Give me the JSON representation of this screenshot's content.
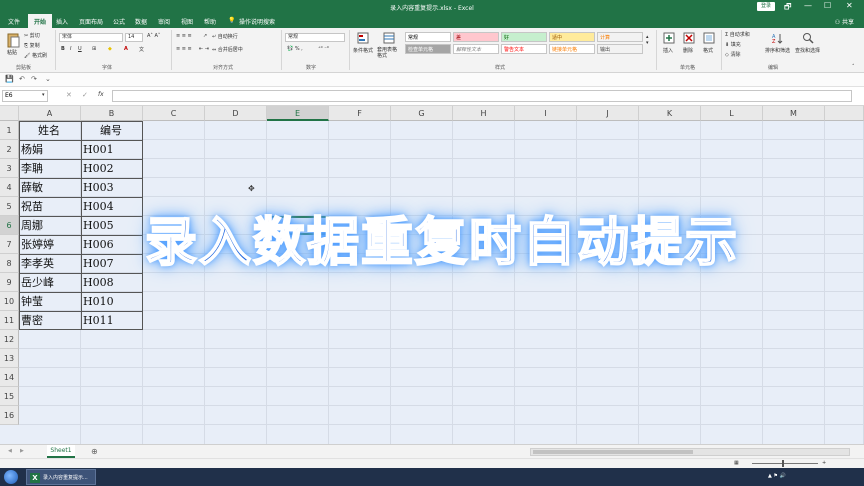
{
  "window": {
    "title": "录入内容重复提示.xlsx - Excel",
    "login_label": "登录",
    "controls": [
      "🗗",
      "—",
      "☐",
      "✕"
    ]
  },
  "tabs": [
    "文件",
    "开始",
    "插入",
    "页面布局",
    "公式",
    "数据",
    "审阅",
    "视图",
    "帮助"
  ],
  "tell_me": "操作说明搜索",
  "share_label": "共享",
  "ribbon": {
    "clipboard": {
      "paste": "粘贴",
      "cut": "剪切",
      "copy": "复制",
      "format_painter": "格式刷",
      "group": "剪贴板"
    },
    "font": {
      "name": "宋体",
      "size": "14",
      "group": "字体"
    },
    "alignment": {
      "wrap": "自动换行",
      "merge": "合并后居中",
      "group": "对齐方式"
    },
    "number": {
      "format": "常规",
      "group": "数字"
    },
    "styles": {
      "conditional": "条件格式",
      "table": "套用表格格式",
      "cells": [
        {
          "label": "常规",
          "bg": "#ffffff",
          "fg": "#000000"
        },
        {
          "label": "差",
          "bg": "#ffc7ce",
          "fg": "#9c0006"
        },
        {
          "label": "好",
          "bg": "#c6efce",
          "fg": "#006100"
        },
        {
          "label": "适中",
          "bg": "#ffeb9c",
          "fg": "#9c5700"
        },
        {
          "label": "计算",
          "bg": "#f2f2f2",
          "fg": "#fa7d00"
        },
        {
          "label": "检查单元格",
          "bg": "#a5a5a5",
          "fg": "#ffffff"
        },
        {
          "label": "解释性文本",
          "bg": "#ffffff",
          "fg": "#7f7f7f"
        },
        {
          "label": "警告文本",
          "bg": "#ffffff",
          "fg": "#ff0000"
        },
        {
          "label": "链接单元格",
          "bg": "#ffffff",
          "fg": "#fa7d00"
        },
        {
          "label": "输出",
          "bg": "#f2f2f2",
          "fg": "#3f3f3f"
        }
      ],
      "group": "样式"
    },
    "cells_group": {
      "insert": "插入",
      "delete": "删除",
      "format": "格式",
      "group": "单元格"
    },
    "editing": {
      "autosum": "自动求和",
      "fill": "填充",
      "clear": "清除",
      "sort": "排序和筛选",
      "find": "查找和选择",
      "group": "编辑"
    }
  },
  "formula_bar": {
    "name_box": "E6",
    "fx": "fx",
    "content": ""
  },
  "columns": [
    "A",
    "B",
    "C",
    "D",
    "E",
    "F",
    "G",
    "H",
    "I",
    "J",
    "K",
    "L",
    "M"
  ],
  "selected_column": "E",
  "selected_row": "6",
  "rows": [
    "1",
    "2",
    "3",
    "4",
    "5",
    "6",
    "7",
    "8",
    "9",
    "10",
    "11",
    "12",
    "13",
    "14",
    "15",
    "16"
  ],
  "table": {
    "header": [
      "姓名",
      "编号"
    ],
    "rows": [
      [
        "杨娟",
        "H001"
      ],
      [
        "李聃",
        "H002"
      ],
      [
        "薛敏",
        "H003"
      ],
      [
        "祝苗",
        "H004"
      ],
      [
        "周娜",
        "H005"
      ],
      [
        "张婷婷",
        "H006"
      ],
      [
        "李孝英",
        "H007"
      ],
      [
        "岳少峰",
        "H008"
      ],
      [
        "钟莹",
        "H010"
      ],
      [
        "曹密",
        "H011"
      ]
    ]
  },
  "caption": "录入数据重复时自动提示",
  "sheet_tab": "Sheet1",
  "add_sheet": "⊕",
  "taskbar": {
    "app_label": "录入内容重复提示...",
    "clock": ""
  }
}
